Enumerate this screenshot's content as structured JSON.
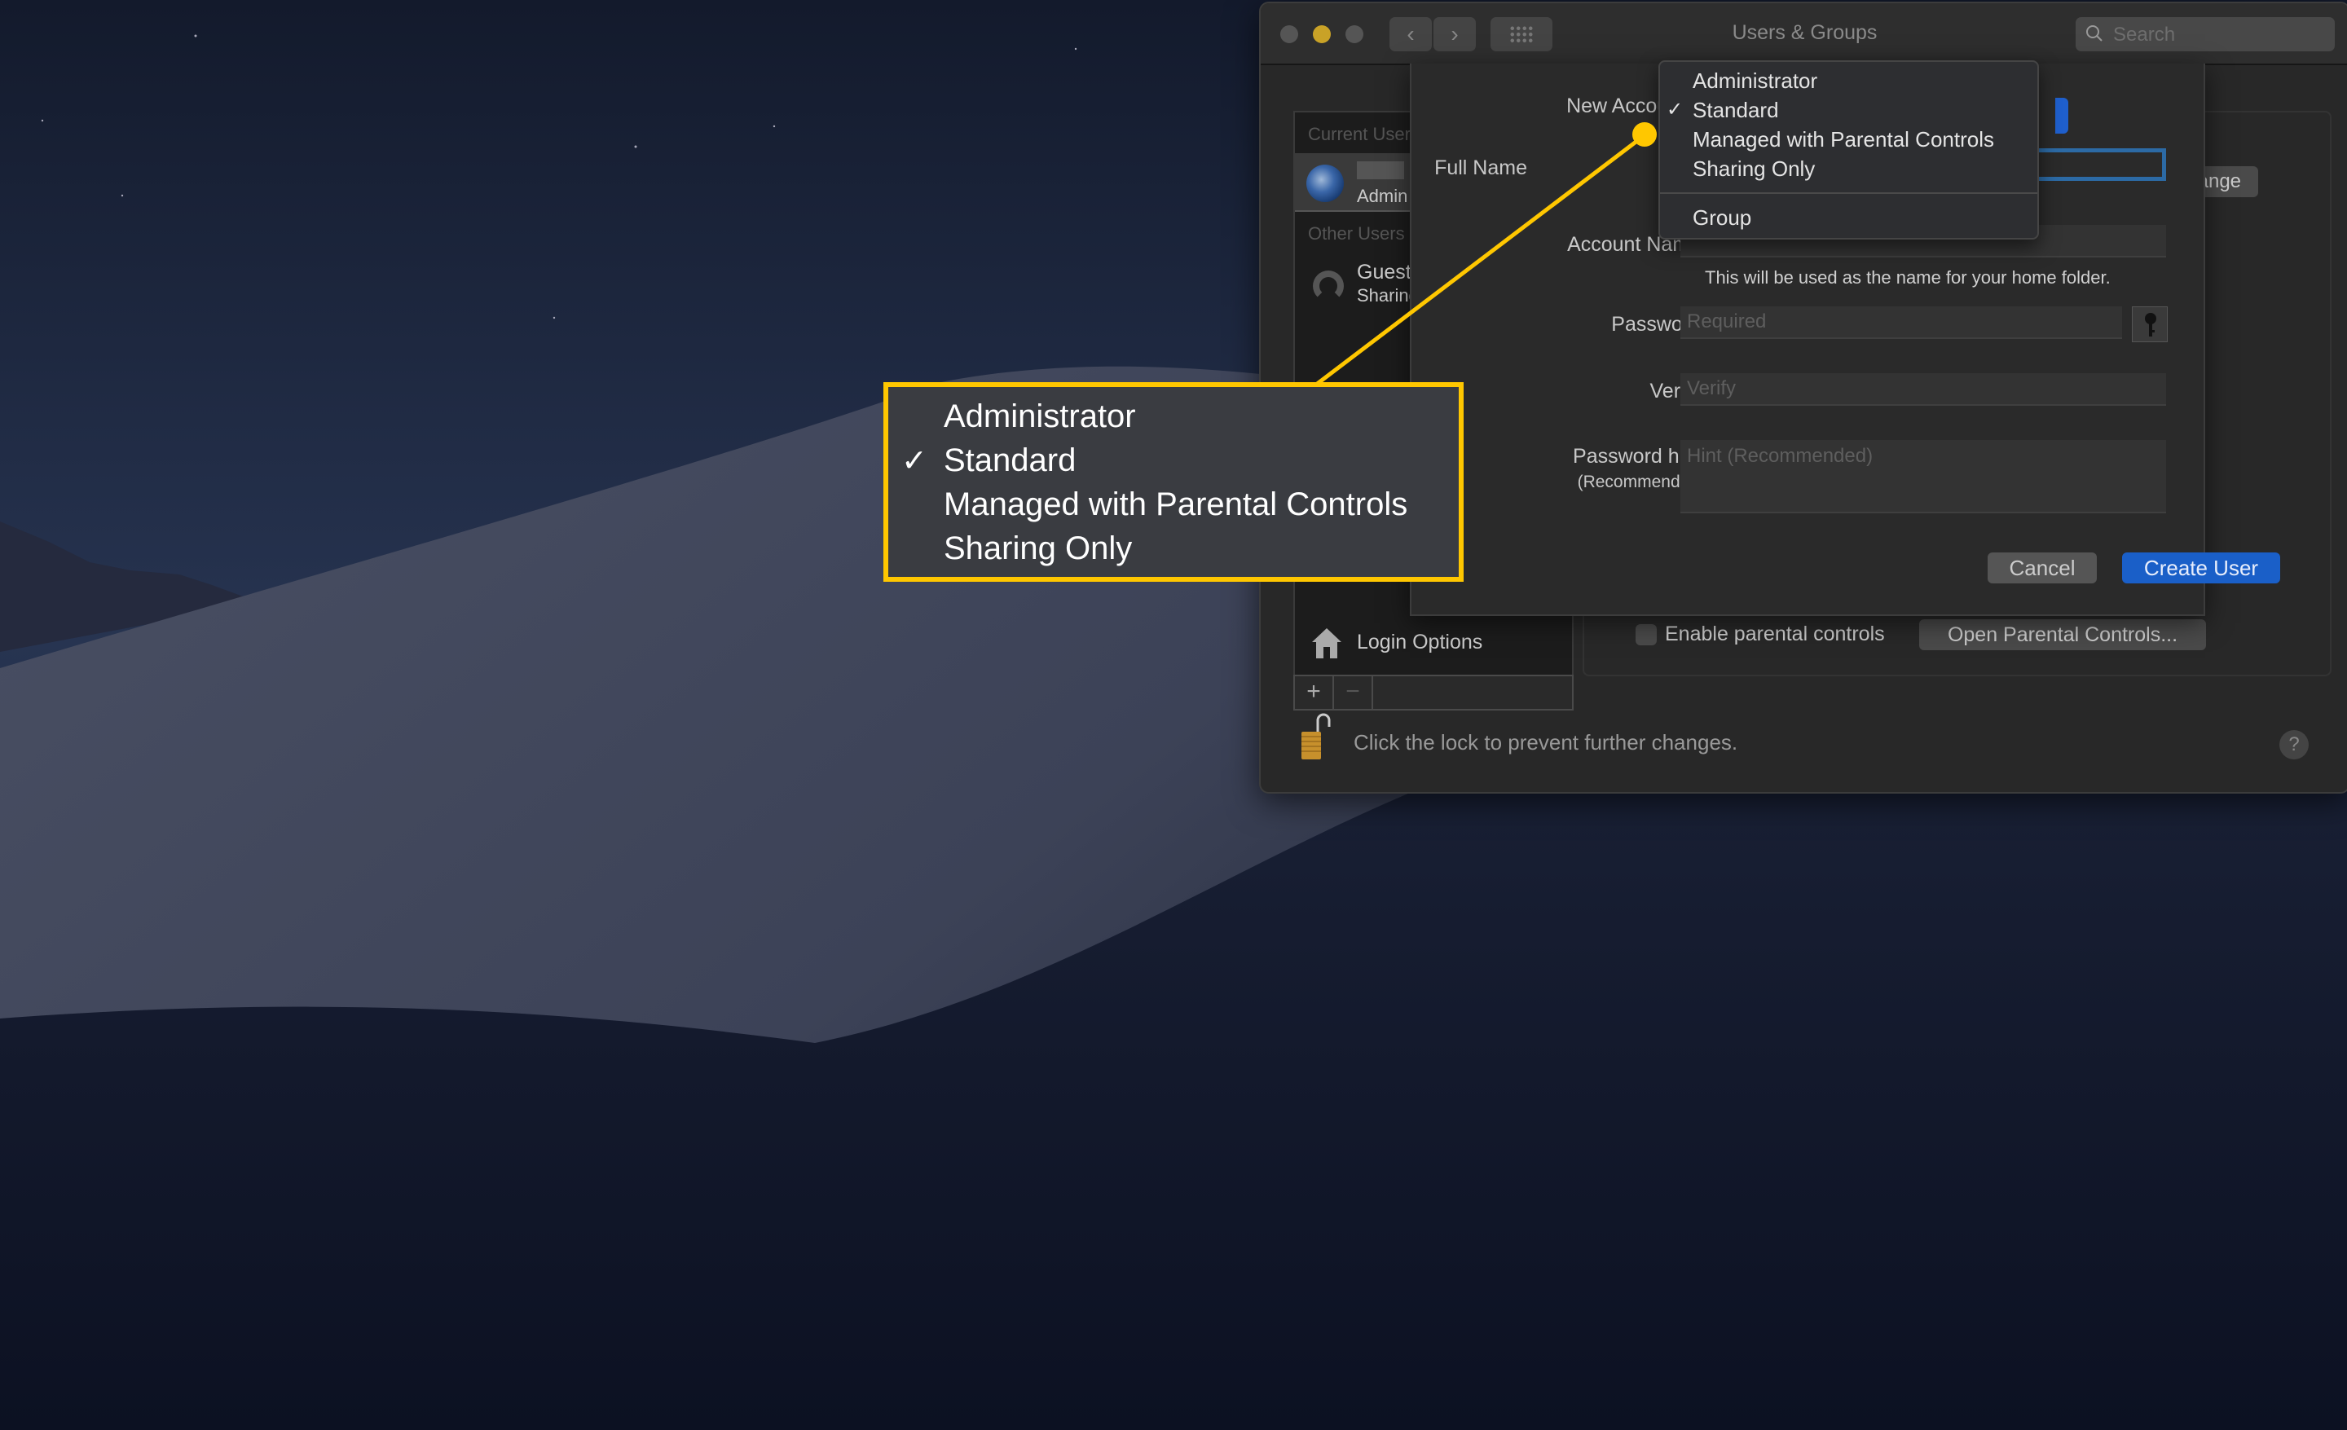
{
  "window": {
    "title": "Users & Groups",
    "search_placeholder": "Search",
    "nav_back": "‹",
    "nav_forward": "›"
  },
  "sidebar": {
    "current_users_header": "Current User",
    "current_user": {
      "role": "Admin"
    },
    "other_users_header": "Other Users",
    "other_users": [
      {
        "name": "Guest User",
        "subtitle": "Sharing only"
      }
    ],
    "login_options_label": "Login Options",
    "add_label": "+",
    "remove_label": "−"
  },
  "right_pane": {
    "change_password_label": "Change Password...",
    "enable_parental_label": "Enable parental controls",
    "enable_parental_checked": false,
    "open_parental_label": "Open Parental Controls..."
  },
  "footer": {
    "lock_text": "Click the lock to prevent further changes.",
    "help_label": "?"
  },
  "sheet": {
    "new_account_label": "New Account",
    "full_name_label": "Full Name",
    "full_name_value": "",
    "account_name_label": "Account Name:",
    "account_name_value": "",
    "account_name_help": "This will be used as the name for your home folder.",
    "password_label": "Password:",
    "password_placeholder": "Required",
    "verify_label": "Verify:",
    "verify_placeholder": "Verify",
    "hint_label": "Password hint:",
    "hint_sub_label": "(Recommended)",
    "hint_placeholder": "Hint (Recommended)",
    "cancel_label": "Cancel",
    "create_label": "Create User"
  },
  "account_type_menu": {
    "selected": "Standard",
    "check_glyph": "✓",
    "items": [
      "Administrator",
      "Standard",
      "Managed with Parental Controls",
      "Sharing Only"
    ],
    "extra_items": [
      "Group"
    ]
  },
  "callout": {
    "check_glyph": "✓",
    "items": [
      "Administrator",
      "Standard",
      "Managed with Parental Controls",
      "Sharing Only"
    ],
    "accent_color": "#ffc700"
  },
  "colors": {
    "accent_blue": "#1a5fc8",
    "minimize_yellow": "#c9a227",
    "highlight_yellow": "#ffc700"
  }
}
